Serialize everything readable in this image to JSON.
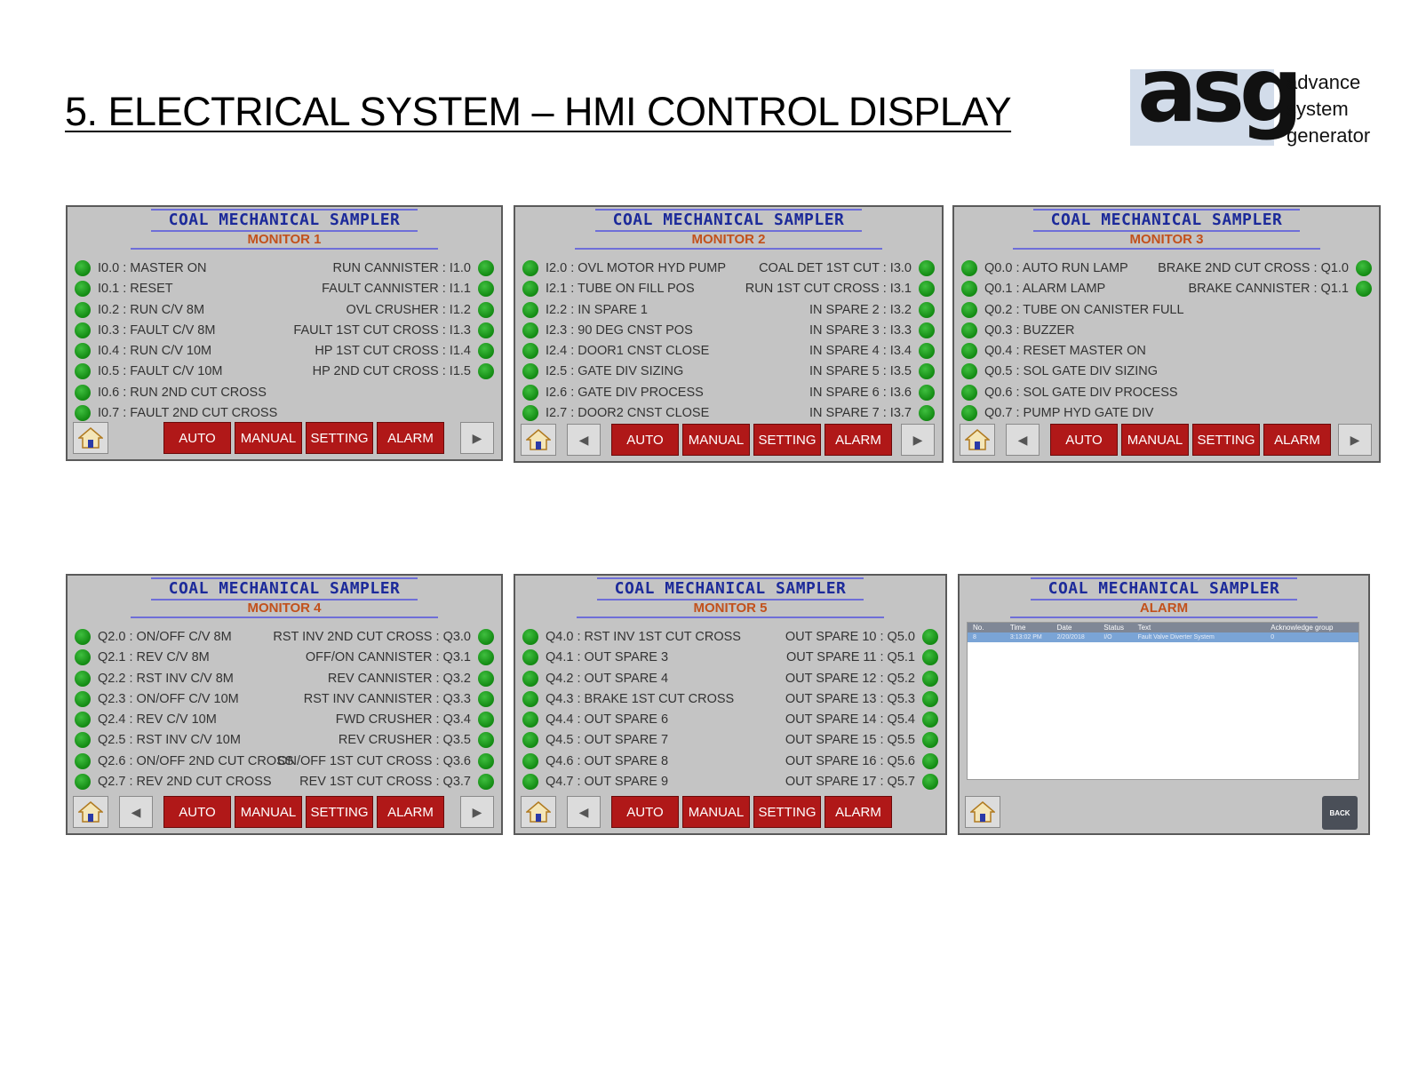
{
  "page": {
    "title": "5. ELECTRICAL SYSTEM – HMI CONTROL DISPLAY"
  },
  "logo": {
    "mark": "asg",
    "line1": "advance",
    "line2": "system",
    "line3": "generator"
  },
  "colors": {
    "panel_bg": "#c4c4c4",
    "title_blue": "#1c2a9a",
    "subtitle_orange": "#c2511c",
    "button_red": "#b01818",
    "led_green": "#138a13"
  },
  "nav": {
    "auto": "AUTO",
    "manual": "MANUAL",
    "setting": "SETTING",
    "alarm": "ALARM",
    "back": "BACK"
  },
  "monitors": [
    {
      "title": "COAL MECHANICAL SAMPLER",
      "subtitle": "MONITOR 1",
      "left": [
        "I0.0 : MASTER ON",
        "I0.1 : RESET",
        "I0.2 : RUN C/V 8M",
        "I0.3 : FAULT C/V 8M",
        "I0.4 : RUN C/V 10M",
        "I0.5 : FAULT C/V 10M",
        "I0.6 : RUN 2ND CUT CROSS",
        "I0.7 : FAULT 2ND CUT CROSS"
      ],
      "right": [
        "RUN CANNISTER : I1.0",
        "FAULT CANNISTER : I1.1",
        "OVL CRUSHER : I1.2",
        "FAULT 1ST CUT CROSS : I1.3",
        "HP 1ST CUT CROSS : I1.4",
        "HP 2ND CUT CROSS : I1.5"
      ]
    },
    {
      "title": "COAL MECHANICAL SAMPLER",
      "subtitle": "MONITOR 2",
      "left": [
        "I2.0 : OVL MOTOR HYD PUMP",
        "I2.1 : TUBE ON FILL POS",
        "I2.2 : IN SPARE 1",
        "I2.3 : 90 DEG CNST POS",
        "I2.4 : DOOR1 CNST CLOSE",
        "I2.5 : GATE DIV SIZING",
        "I2.6 : GATE DIV PROCESS",
        "I2.7 : DOOR2 CNST CLOSE"
      ],
      "right": [
        "COAL DET 1ST CUT : I3.0",
        "RUN 1ST CUT CROSS : I3.1",
        "IN SPARE 2 : I3.2",
        "IN SPARE 3 : I3.3",
        "IN SPARE 4 : I3.4",
        "IN SPARE 5 : I3.5",
        "IN SPARE 6 : I3.6",
        "IN SPARE 7 : I3.7"
      ]
    },
    {
      "title": "COAL MECHANICAL SAMPLER",
      "subtitle": "MONITOR 3",
      "left": [
        "Q0.0 : AUTO RUN LAMP",
        "Q0.1 : ALARM LAMP",
        "Q0.2 : TUBE ON CANISTER FULL",
        "Q0.3 : BUZZER",
        "Q0.4 : RESET MASTER ON",
        "Q0.5 : SOL GATE DIV SIZING",
        "Q0.6 : SOL GATE DIV PROCESS",
        "Q0.7 : PUMP HYD GATE DIV"
      ],
      "right": [
        "BRAKE 2ND CUT CROSS : Q1.0",
        "BRAKE CANNISTER : Q1.1"
      ]
    },
    {
      "title": "COAL MECHANICAL SAMPLER",
      "subtitle": "MONITOR 4",
      "left": [
        "Q2.0 : ON/OFF C/V 8M",
        "Q2.1 : REV C/V 8M",
        "Q2.2 : RST INV C/V 8M",
        "Q2.3 : ON/OFF C/V 10M",
        "Q2.4 : REV C/V 10M",
        "Q2.5 : RST INV C/V 10M",
        "Q2.6 : ON/OFF 2ND CUT CROSS",
        "Q2.7 : REV 2ND CUT CROSS"
      ],
      "right": [
        "RST INV 2ND CUT CROSS : Q3.0",
        "OFF/ON CANNISTER : Q3.1",
        "REV CANNISTER : Q3.2",
        "RST INV CANNISTER : Q3.3",
        "FWD CRUSHER : Q3.4",
        "REV CRUSHER : Q3.5",
        "ON/OFF 1ST CUT CROSS : Q3.6",
        "REV 1ST CUT CROSS : Q3.7"
      ]
    },
    {
      "title": "COAL MECHANICAL SAMPLER",
      "subtitle": "MONITOR 5",
      "left": [
        "Q4.0 : RST INV 1ST CUT CROSS",
        "Q4.1 : OUT SPARE 3",
        "Q4.2 : OUT SPARE 4",
        "Q4.3 : BRAKE 1ST CUT CROSS",
        "Q4.4 : OUT SPARE 6",
        "Q4.5 : OUT SPARE 7",
        "Q4.6 : OUT SPARE 8",
        "Q4.7 : OUT SPARE 9"
      ],
      "right": [
        "OUT SPARE 10 : Q5.0",
        "OUT SPARE 11 : Q5.1",
        "OUT SPARE 12 : Q5.2",
        "OUT SPARE 13 : Q5.3",
        "OUT SPARE 14 : Q5.4",
        "OUT SPARE 15 : Q5.5",
        "OUT SPARE 16 : Q5.6",
        "OUT SPARE 17 : Q5.7"
      ]
    }
  ],
  "alarm_panel": {
    "title": "COAL MECHANICAL SAMPLER",
    "subtitle": "ALARM",
    "columns": [
      "No.",
      "Time",
      "Date",
      "Status",
      "Text",
      "Acknowledge group"
    ],
    "rows": [
      [
        "8",
        "3:13:02 PM",
        "2/20/2018",
        "I/O",
        "Fault Valve Diverter System",
        "0"
      ]
    ]
  }
}
